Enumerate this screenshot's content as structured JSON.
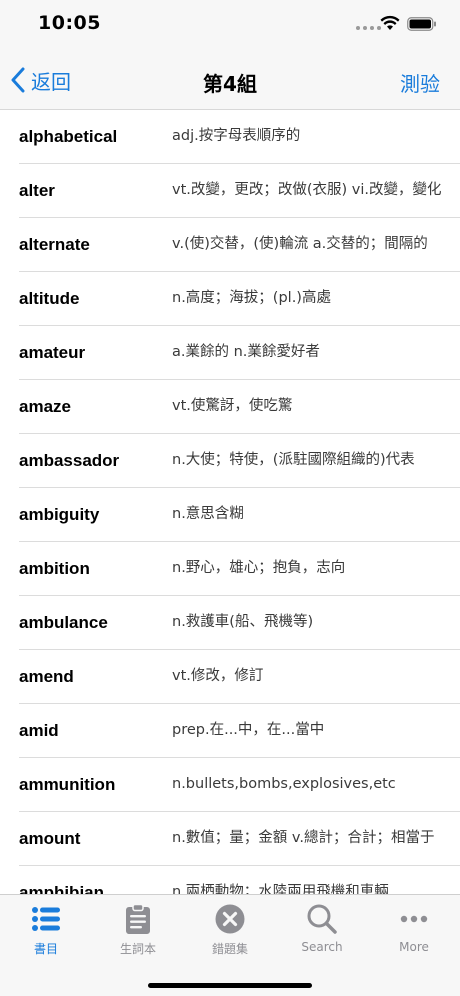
{
  "status": {
    "time": "10:05"
  },
  "nav": {
    "back_label": "返回",
    "title": "第4組",
    "quiz_label": "測验"
  },
  "words": [
    {
      "term": "alphabetical",
      "def": "adj.按字母表順序的"
    },
    {
      "term": "alter",
      "def": "vt.改變，更改；改做(衣服) vi.改變，變化"
    },
    {
      "term": "alternate",
      "def": "v.(使)交替，(使)輪流 a.交替的；間隔的"
    },
    {
      "term": "altitude",
      "def": "n.高度；海拔；(pl.)高處"
    },
    {
      "term": "amateur",
      "def": "a.業餘的 n.業餘愛好者"
    },
    {
      "term": "amaze",
      "def": "vt.使驚訝，使吃驚"
    },
    {
      "term": "ambassador",
      "def": "n.大使；特使，(派駐國際組織的)代表"
    },
    {
      "term": "ambiguity",
      "def": "n.意思含糊"
    },
    {
      "term": "ambition",
      "def": "n.野心，雄心；抱負，志向"
    },
    {
      "term": "ambulance",
      "def": "n.救護車(船、飛機等)"
    },
    {
      "term": "amend",
      "def": "vt.修改，修訂"
    },
    {
      "term": "amid",
      "def": "prep.在...中，在...當中"
    },
    {
      "term": "ammunition",
      "def": "n.bullets,bombs,explosives,etc"
    },
    {
      "term": "amount",
      "def": "n.數值；量；金額 v.總計；合計；相當于"
    },
    {
      "term": "amphibian",
      "def": "n.兩栖動物；水陸兩用飛機和車輛"
    }
  ],
  "tabs": [
    {
      "label": "書目",
      "icon": "list-icon",
      "active": true
    },
    {
      "label": "生詞本",
      "icon": "clipboard-icon",
      "active": false
    },
    {
      "label": "錯題集",
      "icon": "x-circle-icon",
      "active": false
    },
    {
      "label": "Search",
      "icon": "search-icon",
      "active": false
    },
    {
      "label": "More",
      "icon": "more-icon",
      "active": false
    }
  ],
  "colors": {
    "accent": "#1a7cdb",
    "inactive": "#8e8e93"
  }
}
